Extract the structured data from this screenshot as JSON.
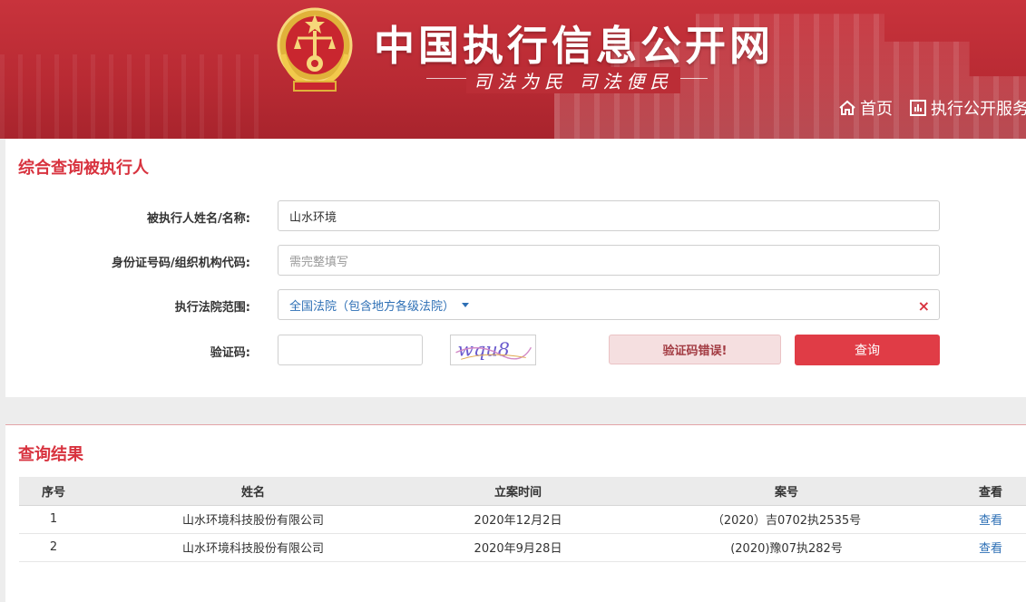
{
  "header": {
    "site_title": "中国执行信息公开网",
    "slogan": "司法为民   司法便民",
    "nav": [
      {
        "label": "首页",
        "icon": "home-icon"
      },
      {
        "label": "执行公开服务",
        "icon": "chart-icon"
      }
    ],
    "emblem": "national-court-emblem"
  },
  "search": {
    "title": "综合查询被执行人",
    "name_label": "被执行人姓名/名称:",
    "name_value": "山水环境",
    "id_label": "身份证号码/组织机构代码:",
    "id_placeholder": "需完整填写",
    "court_label": "执行法院范围:",
    "court_value": "全国法院（包含地方各级法院）",
    "clear_symbol": "×",
    "captcha_label": "验证码:",
    "captcha_value": "",
    "captcha_image_text": "wqu8",
    "error_message": "验证码错误!",
    "query_button": "查询"
  },
  "results": {
    "title": "查询结果",
    "columns": [
      "序号",
      "姓名",
      "立案时间",
      "案号",
      "查看"
    ],
    "rows": [
      {
        "seq": "1",
        "name": "山水环境科技股份有限公司",
        "date": "2020年12月2日",
        "case_no": "（2020）吉0702执2535号",
        "view": "查看"
      },
      {
        "seq": "2",
        "name": "山水环境科技股份有限公司",
        "date": "2020年9月28日",
        "case_no": "(2020)豫07执282号",
        "view": "查看"
      }
    ]
  },
  "colors": {
    "header_red": "#bb2d36",
    "accent_red": "#d8333f",
    "button_red": "#e03c46",
    "link_blue": "#2d6fb5"
  }
}
